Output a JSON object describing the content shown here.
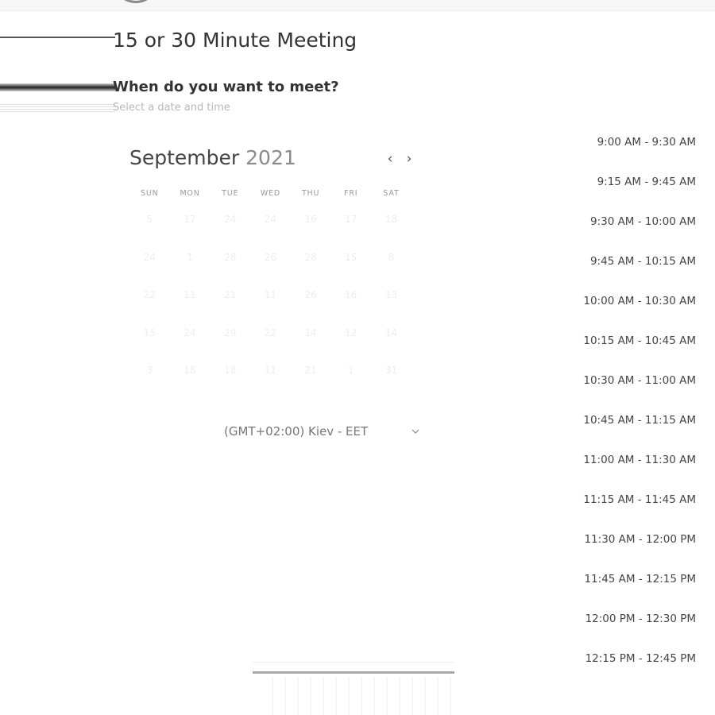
{
  "page": {
    "title": "15 or 30 Minute Meeting",
    "question": "When do you want to meet?",
    "instruction": "Select a date and time"
  },
  "calendar": {
    "month": "September",
    "year": "2021",
    "prev_icon": "chevron-left-icon",
    "next_icon": "chevron-right-icon",
    "weekdays": [
      "SUN",
      "MON",
      "TUE",
      "WED",
      "THU",
      "FRI",
      "SAT"
    ],
    "weeks": [
      [
        "5",
        "17",
        "24",
        "24",
        "16",
        "17",
        "18"
      ],
      [
        "24",
        "1",
        "28",
        "26",
        "28",
        "15",
        "8"
      ],
      [
        "22",
        "11",
        "21",
        "11",
        "26",
        "16",
        "13"
      ],
      [
        "15",
        "24",
        "29",
        "22",
        "14",
        "12",
        "14"
      ],
      [
        "3",
        "18",
        "18",
        "11",
        "21",
        "1",
        "31"
      ]
    ]
  },
  "timezone": {
    "label": "(GMT+02:00) Kiev - EET",
    "icon": "chevron-down-icon"
  },
  "time_slots": [
    "9:00 AM - 9:30 AM",
    "9:15 AM - 9:45 AM",
    "9:30 AM - 10:00 AM",
    "9:45 AM - 10:15 AM",
    "10:00 AM - 10:30 AM",
    "10:15 AM - 10:45 AM",
    "10:30 AM - 11:00 AM",
    "10:45 AM - 11:15 AM",
    "11:00 AM - 11:30 AM",
    "11:15 AM - 11:45 AM",
    "11:30 AM - 12:00 PM",
    "11:45 AM - 12:15 PM",
    "12:00 PM - 12:30 PM",
    "12:15 PM - 12:45 PM"
  ],
  "colors": {
    "text": "#333333",
    "muted": "#b8b8b8",
    "disabled_day": "#eeeeee"
  }
}
